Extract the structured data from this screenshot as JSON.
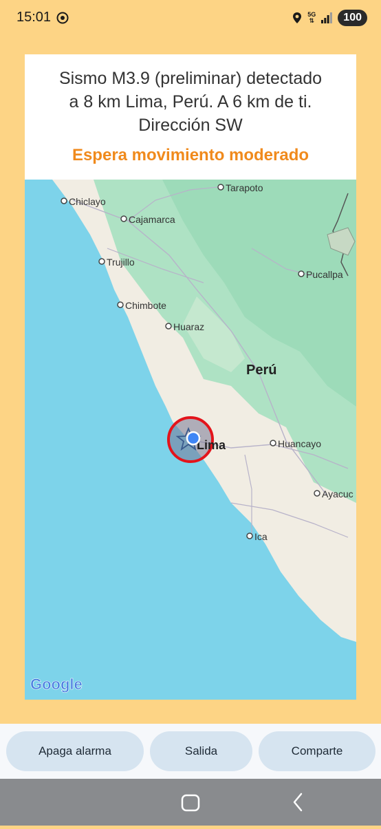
{
  "status_bar": {
    "time": "15:01",
    "network": "5G",
    "battery": "100"
  },
  "alert": {
    "message_lines": [
      "Sismo M3.9 (preliminar) detectado",
      "a 8 km Lima, Perú. A 6 km de ti.",
      "Dirección SW"
    ],
    "warning": "Espera movimiento moderado"
  },
  "map": {
    "country": "Perú",
    "cities": {
      "tarapoto": "Tarapoto",
      "chiclayo": "Chiclayo",
      "cajamarca": "Cajamarca",
      "trujillo": "Trujillo",
      "pucallpa": "Pucallpa",
      "chimbote": "Chimbote",
      "huaraz": "Huaraz",
      "lima": "Lima",
      "huancayo": "Huancayo",
      "ayacucho": "Ayacuc",
      "ica": "Ica"
    },
    "attribution": "Google",
    "colors": {
      "ocean": "#7dd3ea",
      "land": "#f1ede3",
      "forest": "#aee2c4",
      "alert_ring": "#e3141b",
      "location_dot": "#3f86f5"
    }
  },
  "actions": {
    "stop_alarm": "Apaga alarma",
    "exit": "Salida",
    "share": "Comparte"
  }
}
